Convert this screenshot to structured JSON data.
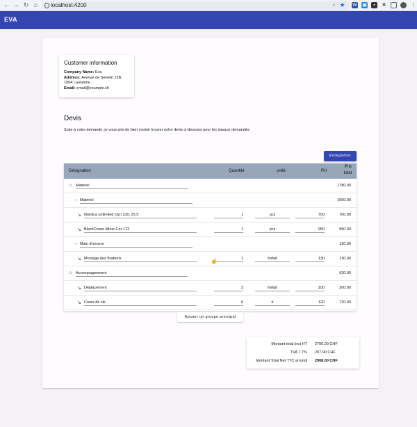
{
  "browser": {
    "url": "localhost:4200"
  },
  "app": {
    "title": "EVA"
  },
  "customer": {
    "heading": "Customer information",
    "company_label": "Company Name:",
    "company_value": "Eva",
    "address_label": "Address:",
    "address_line1": "Avenue de Sévelin 13B,",
    "address_line2": "1004 Lausanne",
    "email_label": "Email:",
    "email_value": "email@example.ch"
  },
  "devis": {
    "title": "Devis",
    "intro": "Suite à votre demande, je vous prie de bien vouloir trouver notre devis ci-dessous pour les travaux demandés.",
    "save_label": "Enregistrer"
  },
  "table": {
    "headers": {
      "designation": "Désignation",
      "quantite": "Quantité",
      "unite": "unité",
      "pu": "PU",
      "prix_total_1": "Prix",
      "prix_total_2": "total"
    },
    "rows": [
      {
        "level": 0,
        "icon": "home-icon",
        "label": "Matériel",
        "qty": "",
        "unit": "",
        "pu": "",
        "total": "1780.00"
      },
      {
        "level": 1,
        "icon": "arrow-right-icon",
        "label": "Matériel",
        "qty": "",
        "unit": "",
        "pu": "",
        "total": "1650.00"
      },
      {
        "level": 2,
        "icon": "arrow-down-right-icon",
        "label": "Nordica unlimited Dyn 130, 25.5",
        "qty": "1",
        "unit": "pcs",
        "pu": "700",
        "total": "700.00"
      },
      {
        "level": 2,
        "icon": "arrow-down-right-icon",
        "label": "BlackCrows Mirus Cor 173",
        "qty": "1",
        "unit": "pcs",
        "pu": "950",
        "total": "950.00"
      },
      {
        "level": 1,
        "icon": "arrow-right-icon",
        "label": "Main d'oeuvre",
        "qty": "",
        "unit": "",
        "pu": "",
        "total": "130.00"
      },
      {
        "level": 2,
        "icon": "arrow-down-right-icon",
        "label": "Montage des fixations",
        "qty": "1",
        "unit": "forfait",
        "pu": "130",
        "total": "130.00"
      },
      {
        "level": 0,
        "icon": "home-icon",
        "label": "Accompagnement",
        "qty": "",
        "unit": "",
        "pu": "",
        "total": "920.00"
      },
      {
        "level": 2,
        "icon": "arrow-down-right-icon",
        "label": "Déplacement",
        "qty": "2",
        "unit": "forfait",
        "pu": "100",
        "total": "200.00"
      },
      {
        "level": 2,
        "icon": "arrow-down-right-icon",
        "label": "Cours de ski",
        "qty": "6",
        "unit": "h",
        "pu": "120",
        "total": "720.00"
      }
    ]
  },
  "add_group_label": "Ajouter un groupe principal",
  "summary": {
    "brut_label": "Montant total brut HT",
    "brut_value": "2700.00 CHF",
    "tva_label": "TVA 7.7%",
    "tva_value": "207.90 CHF",
    "net_label": "Montant Total Net TTC arrondi",
    "net_value": "2908.00 CHF"
  },
  "colors": {
    "primary": "#3446b2",
    "table_header": "#97a6b9",
    "page_bg": "#f4f2f7"
  }
}
